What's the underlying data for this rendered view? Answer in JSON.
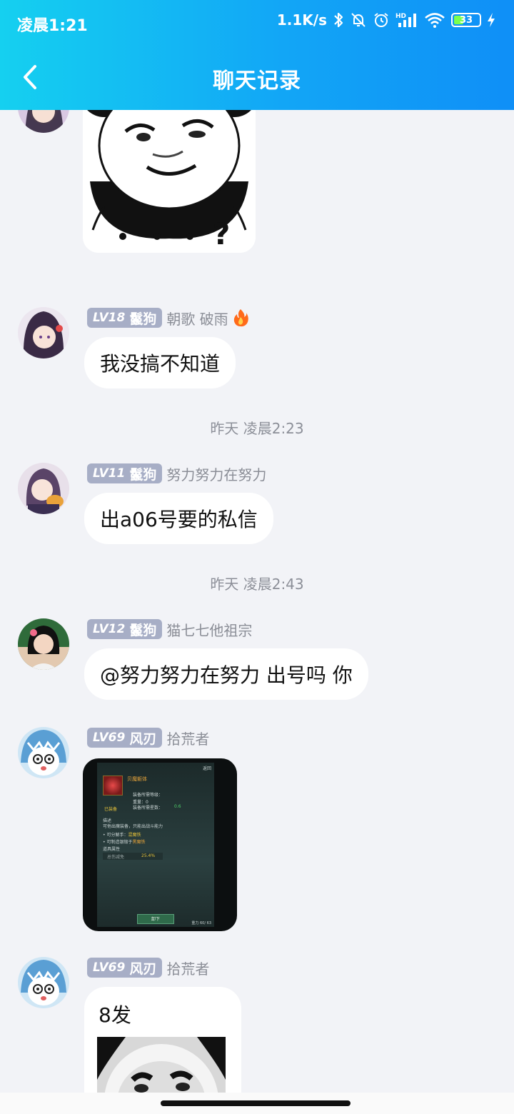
{
  "status_bar": {
    "time": "凌晨1:21",
    "net_speed": "1.1K/s",
    "battery_level": "33",
    "icons": [
      "bluetooth-icon",
      "mute-bell-icon",
      "alarm-icon",
      "hd-signal-icon",
      "wifi-icon",
      "battery-icon",
      "charging-icon"
    ]
  },
  "header": {
    "title": "聊天记录",
    "back_icon": "chevron-left-icon"
  },
  "messages": [
    {
      "type": "sticker",
      "sticker_icon": "panda-meme-sticker"
    },
    {
      "type": "text",
      "badge_level": "LV18",
      "badge_title": "鬣狗",
      "nickname": "朝歌 破雨",
      "nick_icon": "fire-icon",
      "text": "我没搞不知道"
    },
    {
      "type": "time",
      "text": "昨天 凌晨2:23"
    },
    {
      "type": "text",
      "badge_level": "LV11",
      "badge_title": "鬣狗",
      "nickname": "努力努力在努力",
      "text": "出a06号要的私信"
    },
    {
      "type": "time",
      "text": "昨天 凌晨2:43"
    },
    {
      "type": "text",
      "badge_level": "LV12",
      "badge_title": "鬣狗",
      "nickname": "猫七七他祖宗",
      "text": "@努力努力在努力 出号吗 你"
    },
    {
      "type": "image",
      "badge_level": "LV69",
      "badge_title": "风刃",
      "nickname": "拾荒者",
      "shot": {
        "title": "贝魔躯体",
        "close": "返回",
        "row1": "装备所需等级：",
        "row2": "重量：0",
        "row3": "装备所需星数：",
        "row3_val": "0.6",
        "equipped": "已装备",
        "desc_label": "描述",
        "desc": "可他出魔装备，只能出战斗能力",
        "bullet1": "• 可分解手：",
        "bullet1_val": "混魔铁",
        "bullet2": "• 可制造银锻于",
        "bullet2_val": "黑魔铁",
        "attr_label": "道具属性",
        "attr_name": "总伤减免",
        "attr_val": "25.4%",
        "button": "卸下",
        "footer": "重力 60/ 63"
      }
    },
    {
      "type": "text",
      "badge_level": "LV69",
      "badge_title": "风刃",
      "nickname": "拾荒者",
      "text": "8发"
    }
  ],
  "colors": {
    "header_start": "#15d0f0",
    "header_end": "#0f8ff7",
    "badge_bg": "#a7aec6",
    "chat_bg": "#f2f3f7"
  }
}
